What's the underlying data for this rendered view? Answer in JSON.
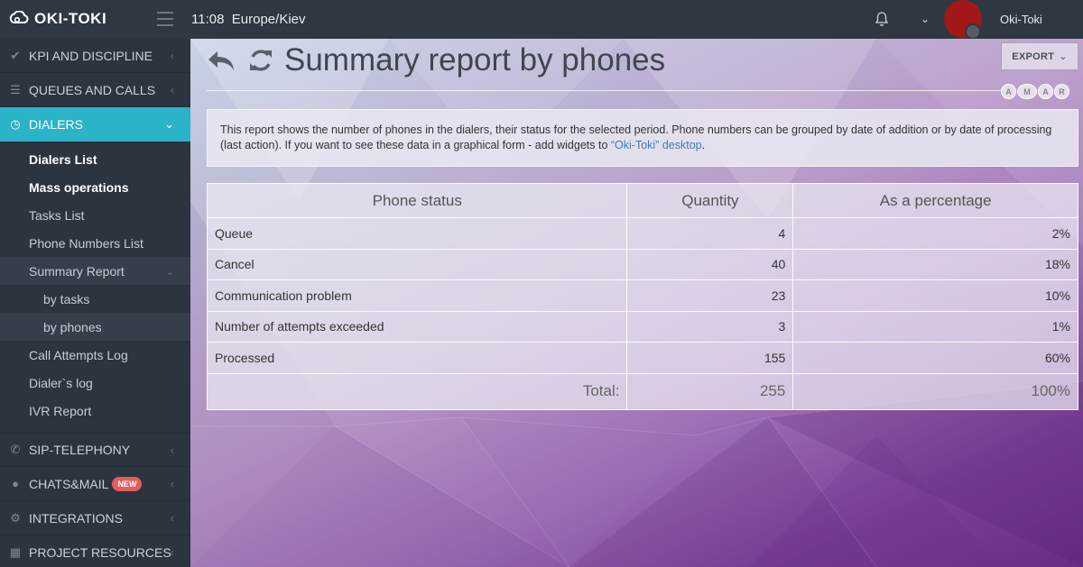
{
  "app": {
    "logo_text": "OKI-TOKI",
    "time": "11:08",
    "timezone": "Europe/Kiev",
    "user": "Oki-Toki"
  },
  "sidebar": {
    "items": [
      {
        "label": "KPI AND DISCIPLINE",
        "icon": "check-icon"
      },
      {
        "label": "QUEUES AND CALLS",
        "icon": "list-icon"
      },
      {
        "label": "DIALERS",
        "icon": "clock-icon"
      }
    ],
    "dialer_subitems": [
      {
        "label": "Dialers List"
      },
      {
        "label": "Mass operations"
      },
      {
        "label": "Tasks List"
      },
      {
        "label": "Phone Numbers List"
      },
      {
        "label": "Summary Report"
      },
      {
        "label": "by tasks"
      },
      {
        "label": "by phones"
      },
      {
        "label": "Call Attempts Log"
      },
      {
        "label": "Dialer`s log"
      },
      {
        "label": "IVR Report"
      }
    ],
    "lower_items": [
      {
        "label": "SIP-TELEPHONY",
        "icon": "phone-icon"
      },
      {
        "label": "CHATS&MAIL",
        "icon": "chat-icon",
        "badge": "NEW"
      },
      {
        "label": "INTEGRATIONS",
        "icon": "gears-icon"
      },
      {
        "label": "PROJECT RESOURCES",
        "icon": "grid-icon"
      }
    ]
  },
  "page": {
    "title": "Summary report by phones",
    "export_label": "EXPORT",
    "role_badges": [
      "A",
      "M",
      "A",
      "R"
    ],
    "info_text": "This report shows the number of phones in the dialers, their status for the selected period. Phone numbers can be grouped by date of addition or by date of processing (last action). If you want to see these data in a graphical form - add widgets to ",
    "info_link": "“Oki-Toki” desktop",
    "info_tail": "."
  },
  "table": {
    "headers": [
      "Phone status",
      "Quantity",
      "As a percentage"
    ],
    "rows": [
      {
        "status": "Queue",
        "quantity": "4",
        "percent": "2%"
      },
      {
        "status": "Cancel",
        "quantity": "40",
        "percent": "18%"
      },
      {
        "status": "Communication problem",
        "quantity": "23",
        "percent": "10%"
      },
      {
        "status": "Number of attempts exceeded",
        "quantity": "3",
        "percent": "1%"
      },
      {
        "status": "Processed",
        "quantity": "155",
        "percent": "60%"
      }
    ],
    "total_label": "Total:",
    "total_quantity": "255",
    "total_percent": "100%"
  },
  "colors": {
    "accent": "#2bb3c8",
    "sidebar_bg": "#2c3440",
    "badge": "#e45d5d",
    "link": "#3b7bbf"
  }
}
